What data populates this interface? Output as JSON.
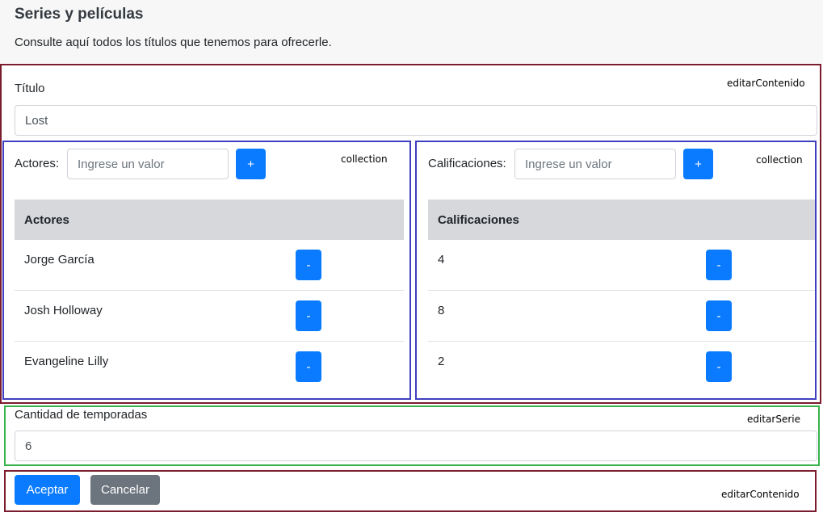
{
  "page": {
    "title": "Series y películas",
    "subtitle": "Consulte aquí todos los títulos que tenemos para ofrecerle."
  },
  "editarContenido": {
    "tag": "editarContenido",
    "titulo_label": "Título",
    "titulo_value": "Lost"
  },
  "actores": {
    "tag": "collection",
    "label": "Actores:",
    "placeholder": "Ingrese un valor",
    "add_label": "+",
    "header": "Actores",
    "remove_label": "-",
    "rows": [
      "Jorge García",
      "Josh Holloway",
      "Evangeline Lilly"
    ]
  },
  "calificaciones": {
    "tag": "collection",
    "label": "Calificaciones:",
    "placeholder": "Ingrese un valor",
    "add_label": "+",
    "header": "Calificaciones",
    "remove_label": "-",
    "rows": [
      "4",
      "8",
      "2"
    ]
  },
  "editarSerie": {
    "tag": "editarSerie",
    "temporadas_label": "Cantidad de temporadas",
    "temporadas_value": "6"
  },
  "footer": {
    "tag": "editarContenido",
    "accept_label": "Aceptar",
    "cancel_label": "Cancelar"
  },
  "colors": {
    "primary": "#0a7bff",
    "secondary": "#6c757d",
    "frame_maroon": "#7b1b2e",
    "frame_blue": "#3f3fbf",
    "frame_green": "#38b24a",
    "table_head": "#d6d8db"
  }
}
